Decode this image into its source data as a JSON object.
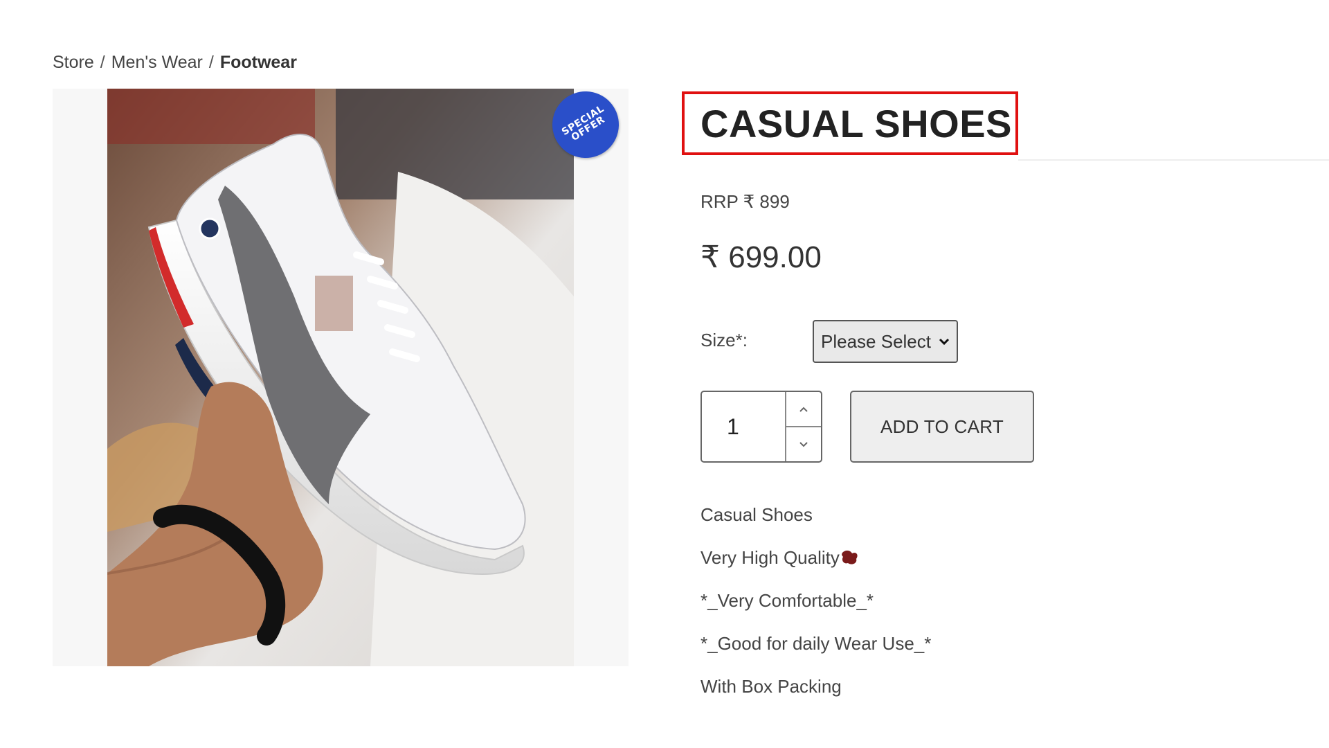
{
  "breadcrumb": {
    "items": [
      "Store",
      "Men's Wear",
      "Footwear"
    ],
    "separator": "/"
  },
  "product": {
    "title": "CASUAL SHOES",
    "rrp": "RRP ₹ 899",
    "price": "₹ 699.00",
    "badge": {
      "line1": "SPECIAL",
      "line2": "OFFER",
      "color": "#2a4fc9"
    },
    "highlight_color": "#e01010"
  },
  "options": {
    "size_label": "Size*:",
    "size_selected": "Please Select"
  },
  "cart": {
    "quantity": "1",
    "add_label": "ADD TO CART"
  },
  "description": [
    "Casual Shoes",
    "Very High Quality",
    "*_Very Comfortable_*",
    "*_Good for daily Wear Use_*",
    "With Box Packing"
  ]
}
